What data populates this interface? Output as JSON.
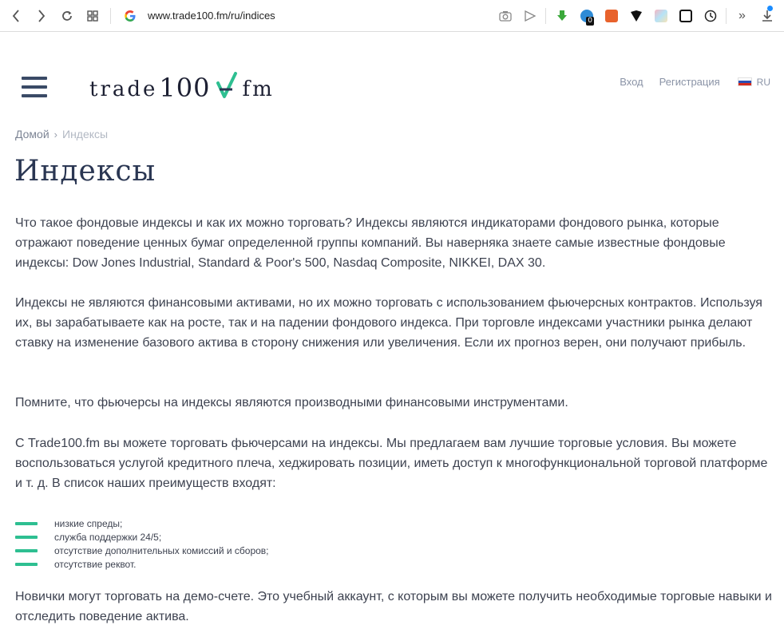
{
  "browser": {
    "url": "www.trade100.fm/ru/indices",
    "back_icon": "chevron-left-icon",
    "forward_icon": "chevron-right-icon",
    "reload_icon": "reload-icon",
    "apps_icon": "grid-icon",
    "extension_badge": "0",
    "more_label": "»"
  },
  "header": {
    "logo_part1": "trade",
    "logo_part2": "100",
    "logo_part3": "fm",
    "login": "Вход",
    "register": "Регистрация",
    "language": "RU"
  },
  "breadcrumb": {
    "home": "Домой",
    "separator": "›",
    "current": "Индексы"
  },
  "page": {
    "title": "Индексы",
    "paragraph1": "Что такое фондовые индексы и как их можно торговать? Индексы являются индикаторами фондового рынка, которые отражают поведение ценных бумаг определенной группы компаний. Вы наверняка знаете самые известные фондовые индексы: Dow Jones Industrial, Standard & Poor's 500, Nasdaq Composite, NIKKEI, DAX 30.",
    "paragraph2": "Индексы не являются финансовыми активами, но их можно торговать с использованием фьючерсных контрактов. Используя их, вы зарабатываете как на росте, так и на падении фондового индекса. При торговле индексами участники рынка делают ставку на изменение базового актива в сторону снижения или увеличения. Если их прогноз верен, они получают прибыль.",
    "paragraph3": "Помните, что фьючерсы на индексы являются производными финансовыми инструментами.",
    "paragraph4": "С Trade100.fm вы можете торговать фьючерсами на индексы. Мы предлагаем вам лучшие торговые условия. Вы можете воспользоваться услугой кредитного плеча, хеджировать позиции, иметь доступ к многофункциональной торговой платформе и т. д. В список наших преимуществ входят:",
    "bullets": [
      "низкие спреды;",
      "служба поддержки 24/5;",
      "отсутствие дополнительных комиссий и сборов;",
      "отсутствие реквот."
    ],
    "paragraph5": "Новички могут торговать на демо-счете. Это учебный аккаунт, с которым вы можете получить необходимые торговые навыки и отследить поведение актива."
  },
  "colors": {
    "accent_green": "#2ebf91",
    "title_navy": "#2a3652",
    "nav_gray": "#8a93a6"
  }
}
